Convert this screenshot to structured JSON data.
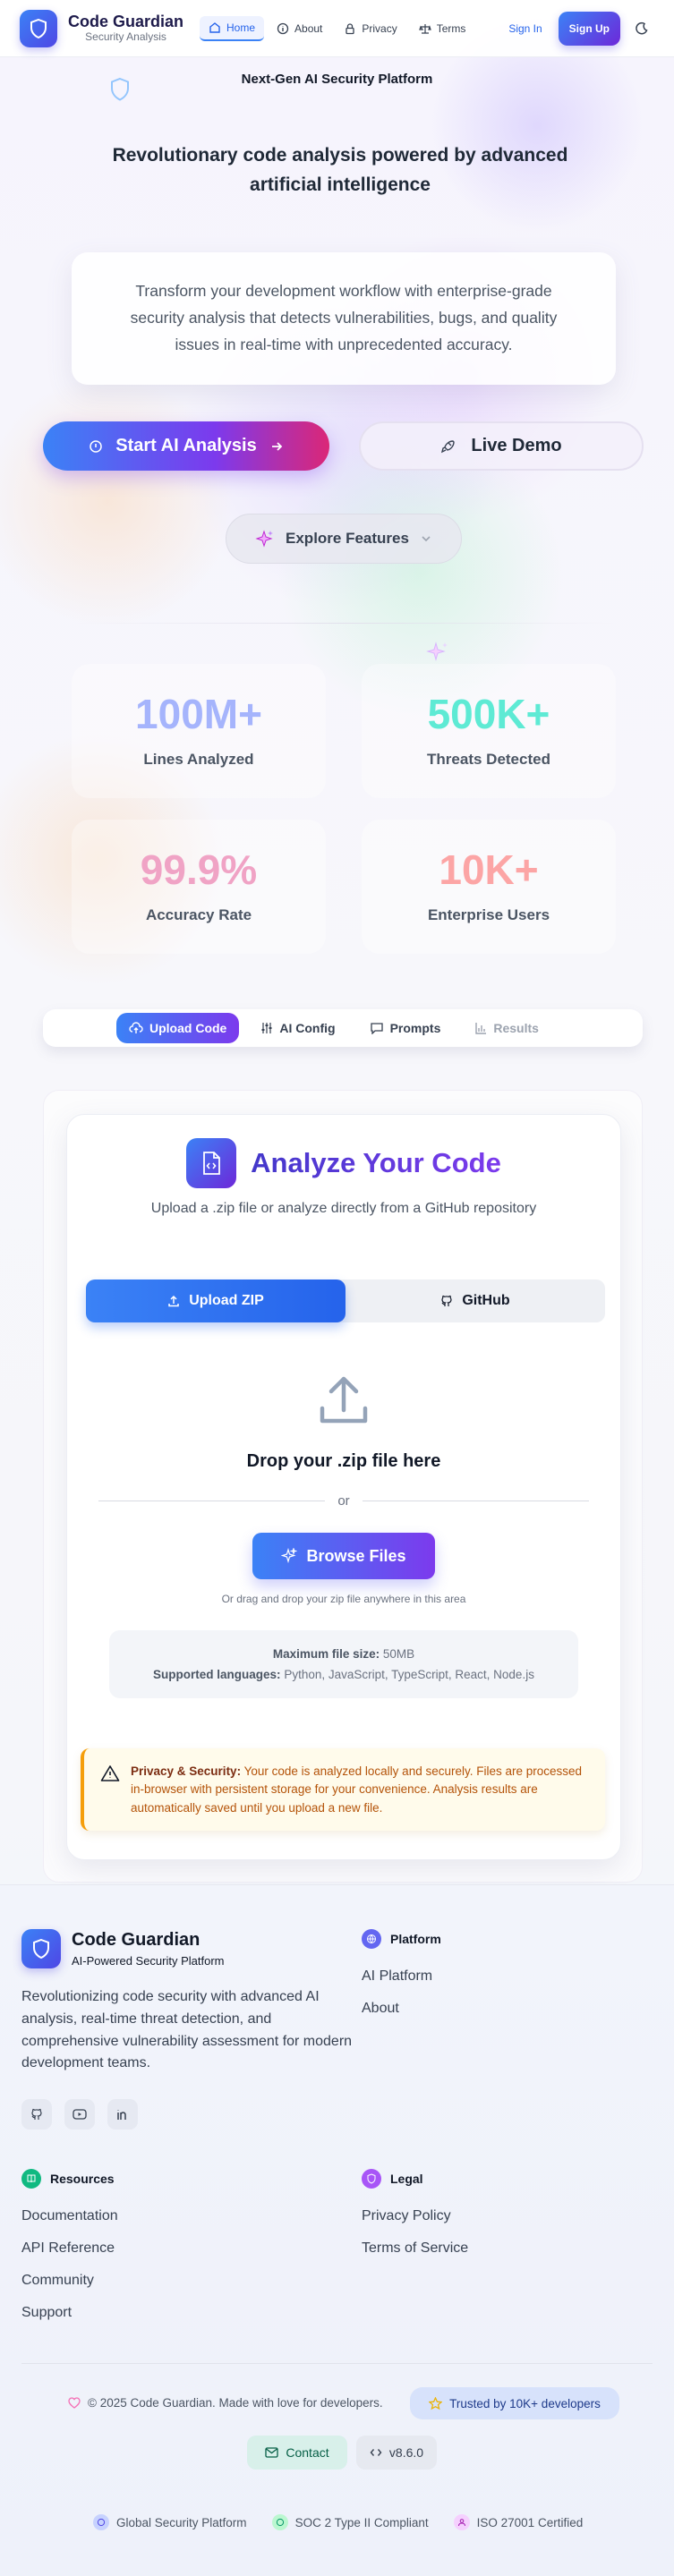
{
  "nav": {
    "brand_title": "Code Guardian",
    "brand_subtitle": "Security Analysis",
    "links": [
      {
        "label": "Home",
        "icon": "home-icon",
        "active": true
      },
      {
        "label": "About",
        "icon": "info-icon",
        "active": false
      },
      {
        "label": "Privacy",
        "icon": "lock-icon",
        "active": false
      },
      {
        "label": "Terms",
        "icon": "scale-icon",
        "active": false
      }
    ],
    "sign_in": "Sign In",
    "sign_up": "Sign Up"
  },
  "hero": {
    "badge": "Next-Gen AI Security Platform",
    "headline": "Revolutionary code analysis powered by advanced artificial intelligence",
    "description": "Transform your development workflow with enterprise-grade security analysis that detects vulnerabilities, bugs, and quality issues in real-time with unprecedented accuracy.",
    "start_button": "Start AI Analysis",
    "demo_button": "Live Demo",
    "explore_button": "Explore Features"
  },
  "stats": [
    {
      "value": "100M+",
      "label": "Lines Analyzed",
      "color": "#a5b4fc"
    },
    {
      "value": "500K+",
      "label": "Threats Detected",
      "color": "#5eead4"
    },
    {
      "value": "99.9%",
      "label": "Accuracy Rate",
      "color": "#f0a3c5"
    },
    {
      "value": "10K+",
      "label": "Enterprise Users",
      "color": "#fca5a5"
    }
  ],
  "tabs": [
    {
      "label": "Upload Code",
      "icon": "cloud-upload-icon",
      "state": "active"
    },
    {
      "label": "AI Config",
      "icon": "sliders-icon",
      "state": "normal"
    },
    {
      "label": "Prompts",
      "icon": "message-icon",
      "state": "normal"
    },
    {
      "label": "Results",
      "icon": "bar-chart-icon",
      "state": "disabled"
    }
  ],
  "analyze": {
    "title": "Analyze Your Code",
    "subtitle": "Upload a .zip file or analyze directly from a GitHub repository",
    "segment_zip": "Upload ZIP",
    "segment_github": "GitHub",
    "drop_title": "Drop your .zip file here",
    "or": "or",
    "browse": "Browse Files",
    "drag_hint": "Or drag and drop your zip file anywhere in this area",
    "max_size_label": "Maximum file size:",
    "max_size_value": "50MB",
    "languages_label": "Supported languages:",
    "languages_value": "Python, JavaScript, TypeScript, React, Node.js",
    "privacy_label": "Privacy & Security:",
    "privacy_text": "Your code is analyzed locally and securely. Files are processed in-browser with persistent storage for your convenience. Analysis results are automatically saved until you upload a new file."
  },
  "footer": {
    "brand_title": "Code Guardian",
    "brand_subtitle": "AI-Powered Security Platform",
    "description": "Revolutionizing code security with advanced AI analysis, real-time threat detection, and comprehensive vulnerability assessment for modern development teams.",
    "platform_heading": "Platform",
    "platform_links": [
      "AI Platform",
      "About"
    ],
    "resources_heading": "Resources",
    "resources_links": [
      "Documentation",
      "API Reference",
      "Community",
      "Support"
    ],
    "legal_heading": "Legal",
    "legal_links": [
      "Privacy Policy",
      "Terms of Service"
    ],
    "copyright": "© 2025 Code Guardian. Made with love for developers.",
    "trusted": "Trusted by 10K+ developers",
    "contact": "Contact",
    "version": "v8.6.0",
    "certs": [
      "Global Security Platform",
      "SOC 2 Type II Compliant",
      "ISO 27001 Certified"
    ]
  }
}
